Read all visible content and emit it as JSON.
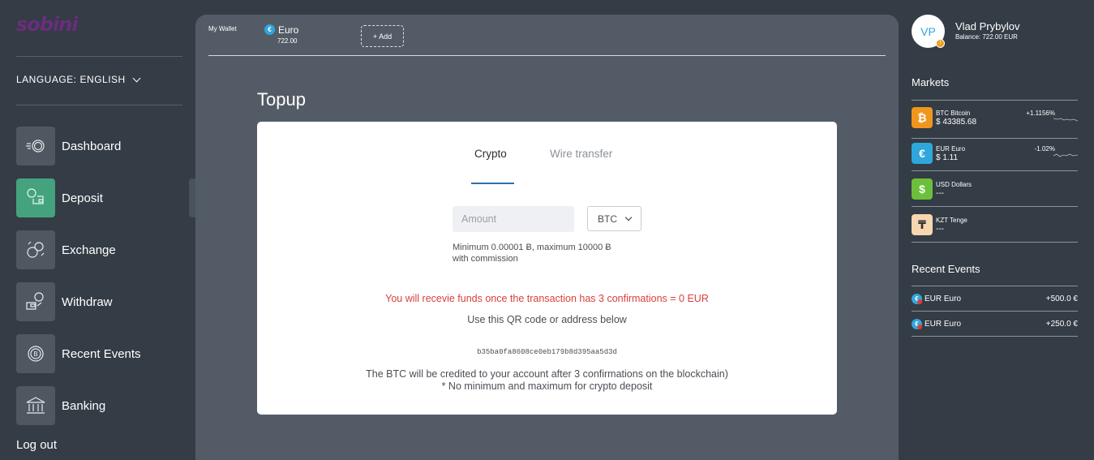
{
  "sidebar": {
    "logo": "sobini",
    "language_label": "LANGUAGE:",
    "language_value": "ENGLISH",
    "nav": [
      {
        "label": "Dashboard",
        "icon": "dashboard-coin-icon"
      },
      {
        "label": "Deposit",
        "icon": "deposit-wallet-icon",
        "active": true
      },
      {
        "label": "Exchange",
        "icon": "exchange-coins-icon"
      },
      {
        "label": "Withdraw",
        "icon": "withdraw-wallet-icon"
      },
      {
        "label": "Recent Events",
        "icon": "bitcoin-coin-icon"
      },
      {
        "label": "Banking",
        "icon": "bank-icon"
      }
    ],
    "logout": "Log out"
  },
  "wallet": {
    "label": "My Wallet",
    "currency": "Euro",
    "amount": "722.00",
    "add_label": "+ Add"
  },
  "topup": {
    "title": "Topup",
    "tabs": [
      "Crypto",
      "Wire transfer"
    ],
    "active_tab": "Crypto",
    "amount_placeholder": "Amount",
    "currency_selected": "BTC",
    "limits_line1": "Minimum 0.00001 Ƀ, maximum 10000 Ƀ",
    "limits_line2": "with commission",
    "warning": "You will recevie funds once the transaction has 3 confirmations = 0 EUR",
    "qr_note": "Use this QR code or address below",
    "address": "b35ba0fa8608ce0eb179b8d395aa5d3d",
    "credit_line1": "The BTC will be credited to your account after 3 confirmations on the blockchain)",
    "credit_line2": "* No minimum and maximum for crypto deposit"
  },
  "user": {
    "initials": "VP",
    "name": "Vlad Prybylov",
    "balance": "Balance: 722.00 EUR"
  },
  "markets": {
    "title": "Markets",
    "items": [
      {
        "name": "BTC Bitcoin",
        "price": "$ 43385.68",
        "change": "+1.1156%",
        "icon": "bitcoin-icon",
        "color": "#f0961e",
        "glyph": "₿"
      },
      {
        "name": "EUR Euro",
        "price": "$ 1.11",
        "change": "-1.02%",
        "icon": "euro-icon",
        "color": "#2fa7dd",
        "glyph": "€"
      },
      {
        "name": "USD Dollars",
        "price": "---",
        "change": "",
        "icon": "dollar-icon",
        "color": "#6cbf3a",
        "glyph": "$"
      },
      {
        "name": "KZT Tenge",
        "price": "---",
        "change": "",
        "icon": "tenge-icon",
        "color": "#f7d7b0",
        "glyph": "₸"
      }
    ]
  },
  "events": {
    "title": "Recent Events",
    "items": [
      {
        "name": "EUR Euro",
        "amount": "+500.0 €"
      },
      {
        "name": "EUR Euro",
        "amount": "+250.0 €"
      }
    ]
  },
  "colors": {
    "accent_green": "#44a37e",
    "warning_red": "#d9403a",
    "tab_underline": "#2e6fa8",
    "euro_blue": "#2fa7dd"
  }
}
